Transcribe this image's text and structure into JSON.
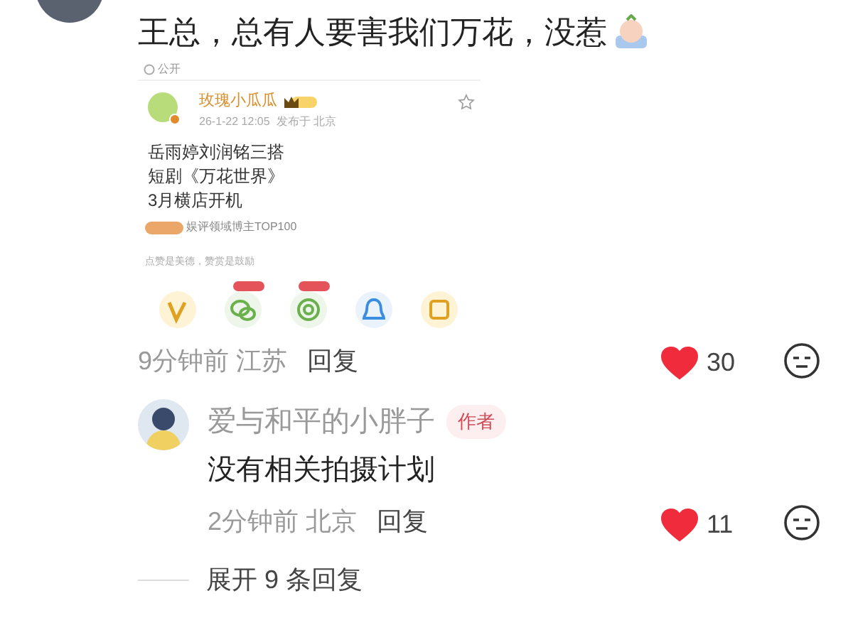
{
  "comment": {
    "text": "王总，总有人要害我们万花，没惹",
    "shared_post": {
      "visibility": "公开",
      "author": "玫瑰小瓜瓜",
      "meta": "26-1-22 12:05  发布于 北京",
      "lines": [
        "岳雨婷刘润铭三搭",
        "短剧《万花世界》",
        "3月横店开机"
      ],
      "tag": "娱评领域博主TOP100",
      "reward_hint": "点赞是美德，赞赏是鼓励",
      "share_targets": [
        {
          "kind": "v"
        },
        {
          "kind": "wechat"
        },
        {
          "kind": "moments"
        },
        {
          "kind": "qq"
        },
        {
          "kind": "poster"
        }
      ]
    },
    "time": "9分钟前",
    "location": "江苏",
    "reply_label": "回复",
    "liked": true,
    "likes": "30"
  },
  "reply": {
    "author": "爱与和平的小胖子",
    "badge": "作者",
    "text": "没有相关拍摄计划",
    "time": "2分钟前",
    "location": "北京",
    "reply_label": "回复",
    "liked": true,
    "likes": "11"
  },
  "expand": "展开 9 条回复"
}
